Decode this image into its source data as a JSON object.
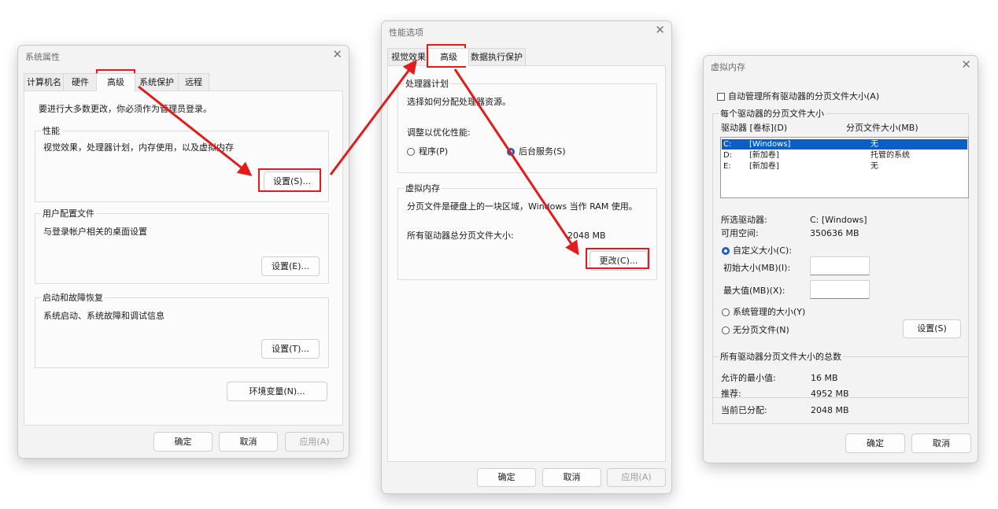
{
  "colors": {
    "annotation": "#e31b1b",
    "selection": "#0a5fc4",
    "window_bg": "#f3f3f3"
  },
  "sysprops": {
    "title": "系统属性",
    "close": "✕",
    "tabs": [
      "计算机名",
      "硬件",
      "高级",
      "系统保护",
      "远程"
    ],
    "admin_note": "要进行大多数更改，你必须作为管理员登录。",
    "perf": {
      "label": "性能",
      "desc": "视觉效果，处理器计划，内存使用，以及虚拟内存",
      "button": "设置(S)..."
    },
    "profile": {
      "label": "用户配置文件",
      "desc": "与登录帐户相关的桌面设置",
      "button": "设置(E)..."
    },
    "startup": {
      "label": "启动和故障恢复",
      "desc": "系统启动、系统故障和调试信息",
      "button": "设置(T)..."
    },
    "env_button": "环境变量(N)...",
    "ok": "确定",
    "cancel": "取消",
    "apply": "应用(A)"
  },
  "perfopts": {
    "title": "性能选项",
    "close": "✕",
    "tabs": [
      "视觉效果",
      "高级",
      "数据执行保护"
    ],
    "sched": {
      "label": "处理器计划",
      "desc": "选择如何分配处理器资源。",
      "optimize": "调整以优化性能:",
      "opt_programs": "程序(P)",
      "opt_background": "后台服务(S)"
    },
    "vmem": {
      "label": "虚拟内存",
      "desc": "分页文件是硬盘上的一块区域，Windows 当作 RAM 使用。",
      "total_label": "所有驱动器总分页文件大小:",
      "total_value": "2048 MB",
      "button": "更改(C)..."
    },
    "ok": "确定",
    "cancel": "取消",
    "apply": "应用(A)"
  },
  "vm": {
    "title": "虚拟内存",
    "close": "✕",
    "auto_manage": "自动管理所有驱动器的分页文件大小(A)",
    "per_drive_label": "每个驱动器的分页文件大小",
    "col_drive": "驱动器 [卷标](D)",
    "col_size": "分页文件大小(MB)",
    "drives": [
      {
        "letter": "C:",
        "label": "[Windows]",
        "size": "无"
      },
      {
        "letter": "D:",
        "label": "[新加卷]",
        "size": "托管的系统"
      },
      {
        "letter": "E:",
        "label": "[新加卷]",
        "size": "无"
      }
    ],
    "selected_drive_label": "所选驱动器:",
    "selected_drive_value": "C:  [Windows]",
    "free_space_label": "可用空间:",
    "free_space_value": "350636 MB",
    "custom_size": "自定义大小(C):",
    "initial_size": "初始大小(MB)(I):",
    "max_size": "最大值(MB)(X):",
    "system_managed": "系统管理的大小(Y)",
    "no_paging": "无分页文件(N)",
    "set_button": "设置(S)",
    "total_label": "所有驱动器分页文件大小的总数",
    "min_label": "允许的最小值:",
    "min_value": "16 MB",
    "rec_label": "推荐:",
    "rec_value": "4952 MB",
    "cur_label": "当前已分配:",
    "cur_value": "2048 MB",
    "ok": "确定",
    "cancel": "取消"
  }
}
